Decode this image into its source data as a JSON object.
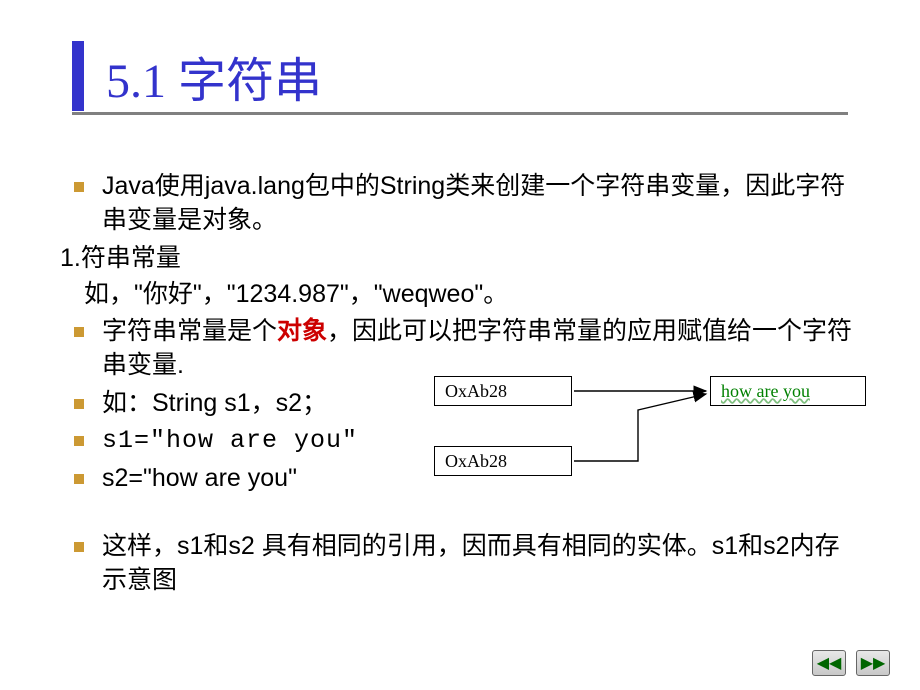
{
  "title": "5.1 字符串",
  "bullets": {
    "b1": "Java使用java.lang包中的String类来创建一个字符串变量，因此字符串变量是对象。",
    "p1": "1.符串常量",
    "p2": "如，\"你好\"，\"1234.987\"，\"weqweo\"。",
    "b2_pre": "字符串常量是个",
    "b2_red": "对象",
    "b2_post": "，因此可以把字符串常量的应用赋值给一个字符串变量.",
    "b3": "如：String s1，s2；",
    "b4": "s1=\"how are you\"",
    "b5": "s2=\"how are you\"",
    "b6": "这样，s1和s2 具有相同的引用，因而具有相同的实体。s1和s2内存示意图"
  },
  "diagram": {
    "box1": "OxAb28",
    "box2": "OxAb28",
    "box3": "how are you"
  },
  "nav": {
    "prev": "◀◀",
    "next": "▶▶"
  }
}
